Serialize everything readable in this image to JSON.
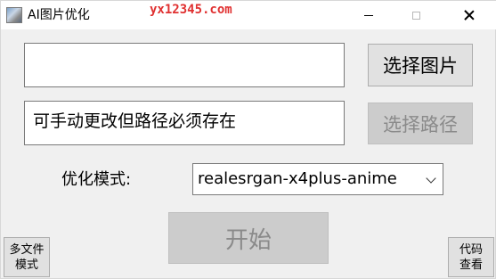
{
  "window": {
    "title": "AI图片优化",
    "app_icon": "picture-app-icon",
    "watermark": "yx12345.com",
    "controls": {
      "minimize_icon": "minimize-icon",
      "maximize_icon": "maximize-icon",
      "close_icon": "close-icon"
    }
  },
  "file_input": {
    "value": ""
  },
  "path_input": {
    "value": "可手动更改但路径必须存在"
  },
  "buttons": {
    "select_image": "选择图片",
    "select_path": "选择路径",
    "start": "开始",
    "multi_file_line1": "多文件",
    "multi_file_line2": "模式",
    "view_code_line1": "代码",
    "view_code_line2": "查看"
  },
  "optimize": {
    "label": "优化模式:",
    "selected": "realesrgan-x4plus-anime"
  }
}
